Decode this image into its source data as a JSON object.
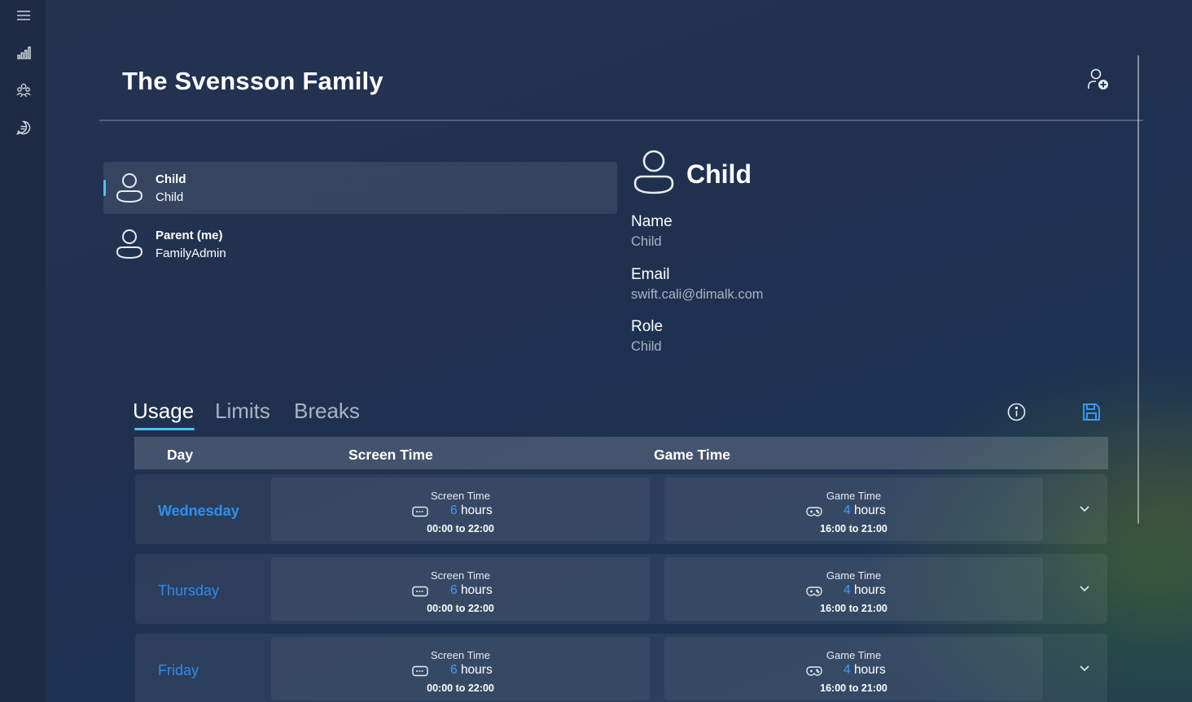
{
  "page": {
    "title": "The Svensson Family"
  },
  "rail": {
    "items": [
      {
        "icon": "hamburger-menu-icon"
      },
      {
        "icon": "bar-chart-icon"
      },
      {
        "icon": "family-icon"
      },
      {
        "icon": "chat-icon"
      }
    ]
  },
  "members": [
    {
      "name": "Child",
      "role": "Child",
      "selected": true
    },
    {
      "name": "Parent (me)",
      "role": "FamilyAdmin",
      "selected": false
    }
  ],
  "detail": {
    "title": "Child",
    "fields": [
      {
        "label": "Name",
        "value": "Child"
      },
      {
        "label": "Email",
        "value": "swift.cali@dimalk.com"
      },
      {
        "label": "Role",
        "value": "Child"
      }
    ]
  },
  "tabs": [
    {
      "label": "Usage",
      "active": true
    },
    {
      "label": "Limits",
      "active": false
    },
    {
      "label": "Breaks",
      "active": false
    }
  ],
  "table": {
    "headers": {
      "day": "Day",
      "screen": "Screen Time",
      "game": "Game Time"
    },
    "rows": [
      {
        "day": "Wednesday",
        "current": true,
        "screen": {
          "title": "Screen Time",
          "hours": "6",
          "unit": "hours",
          "start": "00:00",
          "to": "to",
          "end": "22:00"
        },
        "game": {
          "title": "Game Time",
          "hours": "4",
          "unit": "hours",
          "start": "16:00",
          "to": "to",
          "end": "21:00"
        }
      },
      {
        "day": "Thursday",
        "current": false,
        "screen": {
          "title": "Screen Time",
          "hours": "6",
          "unit": "hours",
          "start": "00:00",
          "to": "to",
          "end": "22:00"
        },
        "game": {
          "title": "Game Time",
          "hours": "4",
          "unit": "hours",
          "start": "16:00",
          "to": "to",
          "end": "21:00"
        }
      },
      {
        "day": "Friday",
        "current": false,
        "screen": {
          "title": "Screen Time",
          "hours": "6",
          "unit": "hours",
          "start": "00:00",
          "to": "to",
          "end": "22:00"
        },
        "game": {
          "title": "Game Time",
          "hours": "4",
          "unit": "hours",
          "start": "16:00",
          "to": "to",
          "end": "21:00"
        }
      }
    ]
  },
  "colors": {
    "accent": "#4cc2ff",
    "link": "#2f8fee",
    "secondary_text": "#a9b3c3"
  }
}
